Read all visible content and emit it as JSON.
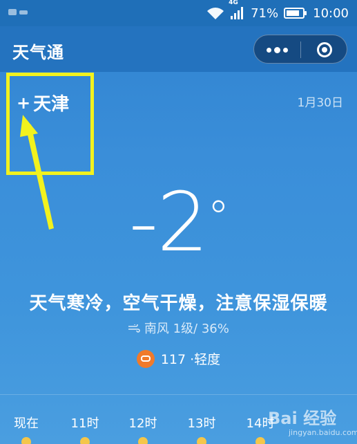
{
  "status_bar": {
    "network": "4G",
    "battery": "71%",
    "time": "10:00"
  },
  "app": {
    "title": "天气通"
  },
  "location": {
    "city": "天津",
    "add_symbol": "+"
  },
  "date": "1月30日",
  "weather": {
    "temperature": "-2",
    "degree_symbol": "°",
    "tip": "天气寒冷，空气干燥，注意保湿保暖",
    "details": "南风 1级/ 36%"
  },
  "aqi": {
    "text": "117 ·轻度",
    "color": "#f07a2b"
  },
  "hourly": {
    "labels": [
      "现在",
      "11时",
      "12时",
      "13时",
      "14时"
    ]
  },
  "watermark": {
    "text": "Bai 经验",
    "url": "jingyan.baidu.com"
  },
  "colors": {
    "highlight": "#f2f21e",
    "background": "#3a8ed9"
  }
}
